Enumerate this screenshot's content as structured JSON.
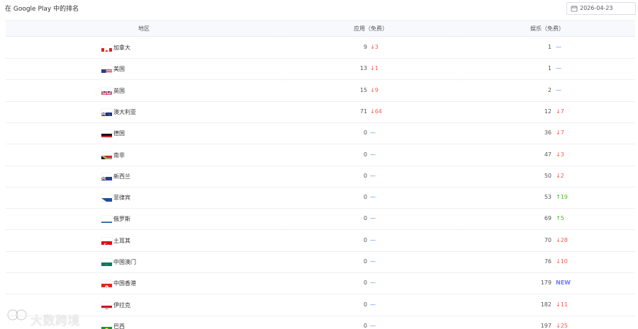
{
  "header": {
    "title": "在 Google Play 中的排名",
    "date_value": "2026-04-23"
  },
  "icons": {
    "calendar": "calendar-icon",
    "arrow_down": "arrow-down-icon",
    "arrow_up": "arrow-up-icon",
    "dash": "dash-icon",
    "watermark": "logo-icon"
  },
  "table": {
    "columns": [
      "地区",
      "应用（免费）",
      "娱乐（免费）"
    ],
    "rows": [
      {
        "region": "加拿大",
        "flag": "canada",
        "app_rank": "9",
        "app_change": "3",
        "app_trend": "down",
        "ent_rank": "1",
        "ent_change": "",
        "ent_trend": "flat"
      },
      {
        "region": "美国",
        "flag": "usa",
        "app_rank": "13",
        "app_change": "1",
        "app_trend": "down",
        "ent_rank": "1",
        "ent_change": "",
        "ent_trend": "flat"
      },
      {
        "region": "英国",
        "flag": "uk",
        "app_rank": "15",
        "app_change": "9",
        "app_trend": "down",
        "ent_rank": "2",
        "ent_change": "",
        "ent_trend": "flat"
      },
      {
        "region": "澳大利亚",
        "flag": "australia",
        "app_rank": "71",
        "app_change": "64",
        "app_trend": "down",
        "ent_rank": "12",
        "ent_change": "7",
        "ent_trend": "down"
      },
      {
        "region": "德国",
        "flag": "germany",
        "app_rank": "0",
        "app_change": "",
        "app_trend": "flat",
        "ent_rank": "36",
        "ent_change": "7",
        "ent_trend": "down"
      },
      {
        "region": "南非",
        "flag": "south-africa",
        "app_rank": "0",
        "app_change": "",
        "app_trend": "flat",
        "ent_rank": "47",
        "ent_change": "3",
        "ent_trend": "down"
      },
      {
        "region": "新西兰",
        "flag": "new-zealand",
        "app_rank": "0",
        "app_change": "",
        "app_trend": "flat",
        "ent_rank": "50",
        "ent_change": "2",
        "ent_trend": "down"
      },
      {
        "region": "菲律宾",
        "flag": "philippines",
        "app_rank": "0",
        "app_change": "",
        "app_trend": "flat",
        "ent_rank": "53",
        "ent_change": "19",
        "ent_trend": "up"
      },
      {
        "region": "俄罗斯",
        "flag": "russia",
        "app_rank": "0",
        "app_change": "",
        "app_trend": "flat",
        "ent_rank": "69",
        "ent_change": "5",
        "ent_trend": "up"
      },
      {
        "region": "土耳其",
        "flag": "turkey",
        "app_rank": "0",
        "app_change": "",
        "app_trend": "flat",
        "ent_rank": "70",
        "ent_change": "28",
        "ent_trend": "down"
      },
      {
        "region": "中国澳门",
        "flag": "macau",
        "app_rank": "0",
        "app_change": "",
        "app_trend": "flat",
        "ent_rank": "76",
        "ent_change": "10",
        "ent_trend": "down"
      },
      {
        "region": "中国香港",
        "flag": "hong-kong",
        "app_rank": "0",
        "app_change": "",
        "app_trend": "flat",
        "ent_rank": "179",
        "ent_change": "NEW",
        "ent_trend": "new"
      },
      {
        "region": "伊拉克",
        "flag": "iraq",
        "app_rank": "0",
        "app_change": "",
        "app_trend": "flat",
        "ent_rank": "182",
        "ent_change": "11",
        "ent_trend": "down"
      },
      {
        "region": "巴西",
        "flag": "brazil",
        "app_rank": "0",
        "app_change": "",
        "app_trend": "flat",
        "ent_rank": "197",
        "ent_change": "25",
        "ent_trend": "down"
      }
    ]
  },
  "watermark": {
    "text": "大数跨境"
  },
  "colors": {
    "down": "#f35b4d",
    "up": "#54b829",
    "flat": "#3d86ff",
    "new": "#6f7cff",
    "header_bg": "#f7f9fc",
    "border": "#edf0f3"
  }
}
